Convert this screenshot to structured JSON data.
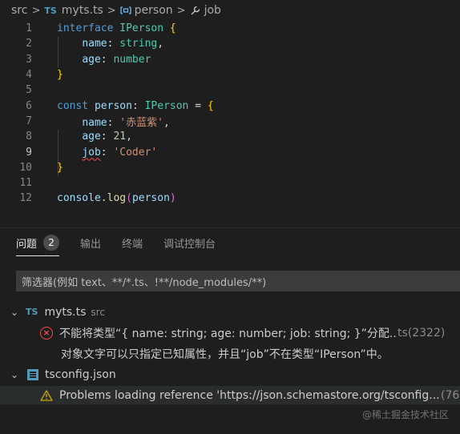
{
  "breadcrumb": {
    "folder": "src",
    "file_badge": "TS",
    "file": "myts.ts",
    "symbol": "person",
    "property": "job"
  },
  "editor": {
    "line_numbers": [
      "1",
      "2",
      "3",
      "4",
      "5",
      "6",
      "7",
      "8",
      "9",
      "10",
      "11",
      "12"
    ],
    "active_line": "9"
  },
  "panel": {
    "tabs": [
      {
        "label": "问题",
        "count": "2"
      },
      {
        "label": "输出"
      },
      {
        "label": "终端"
      },
      {
        "label": "调试控制台"
      }
    ],
    "filter_placeholder": "筛选器(例如 text、**/*.ts、!**/node_modules/**)",
    "groups": [
      {
        "file_badge": "TS",
        "file": "myts.ts",
        "dir": "src",
        "error_line1": "不能将类型“{ name: string; age: number; job: string; }”分配...",
        "error_source": "ts(2322)",
        "error_line2": "对象文字可以只指定已知属性，并且“job”不在类型“IPerson”中。"
      },
      {
        "file": "tsconfig.json",
        "warning": "Problems loading reference 'https://json.schemastore.org/tsconfig...",
        "warning_source": "(76"
      }
    ]
  },
  "watermark": "@稀土掘金技术社区",
  "colors": {
    "error": "#f14c4c",
    "warning": "#cca700",
    "ts": "#519aba"
  }
}
